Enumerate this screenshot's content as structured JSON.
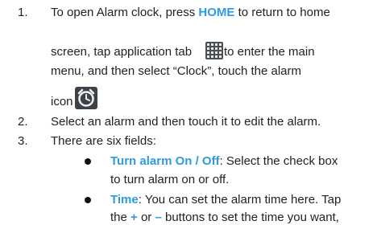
{
  "colors": {
    "accent": "#2e9be0"
  },
  "items": [
    {
      "num": "1.",
      "line1_pre": "To open Alarm clock, press ",
      "line1_kw": "HOME",
      "line1_post": " to return to home",
      "line2_pre": "screen, tap application tab",
      "icon1": "grid-icon",
      "line2_post": "to enter the main",
      "line3": "menu, and then select “Clock”, touch the alarm",
      "line4": "icon",
      "icon2": "alarm-clock-icon"
    },
    {
      "num": "2.",
      "text": "Select an alarm and then touch it to edit the alarm."
    },
    {
      "num": "3.",
      "text": "There are six fields:"
    }
  ],
  "bullets": [
    {
      "kw": "Turn alarm On / Off",
      "rest": ": Select the check box",
      "cont": "to turn alarm on or off."
    },
    {
      "kw": "Time",
      "rest": ": You can set the alarm time here. Tap",
      "cont_pre": "the ",
      "plus": "+",
      "cont_mid": " or ",
      "minus": "–",
      "cont_post": " buttons to set the time you want,"
    }
  ]
}
